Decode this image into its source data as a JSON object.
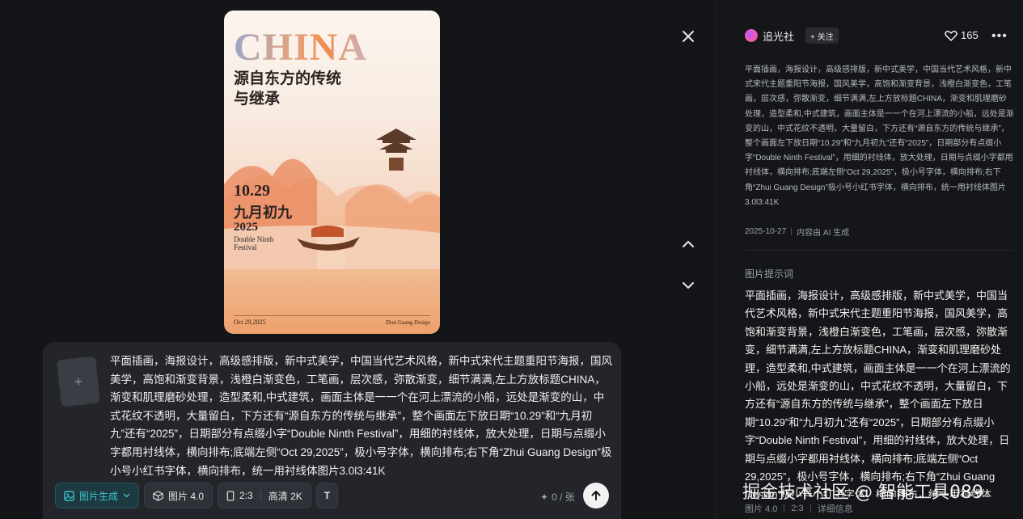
{
  "poster": {
    "headline": "CHINA",
    "title": "源自东方的传统与继承",
    "date_num": "10.29",
    "date_cn": "九月初九",
    "year": "2025",
    "festival": "Double Ninth Festival",
    "foot_date": "Oct 29,2025",
    "foot_brand": "Zhui Guang Design"
  },
  "icons": {
    "close": "close-icon",
    "up": "chevron-up-icon",
    "down": "chevron-down-icon",
    "heart": "heart-icon",
    "more": "more-icon",
    "send": "arrow-up-icon",
    "add": "plus-icon"
  },
  "composer": {
    "add_symbol": "+",
    "prompt": "平面插画，海报设计，高级感排版，新中式美学，中国当代艺术风格，新中式宋代主题重阳节海报，国风美学，高饱和渐变背景，浅橙白渐变色，工笔画，层次感，弥散渐变，细节满满,左上方放标题CHINA，渐变和肌理磨砂处理，造型柔和,中式建筑，画面主体是一一个在河上漂流的小船，远处是渐变的山，中式花纹不透明，大量留白，下方还有“源自东方的传统与继承”，整个画面左下放日期“10.29”和“九月初九”还有“2025”，日期部分有点缀小字“Double Ninth Festival”，用细的衬线体，放大处理，日期与点缀小字都用衬线体，横向排布;底端左侧“Oct 29,2025”，极小号字体，横向排布;右下角“Zhui Guang Design”极小号小红书字体，横向排布，统一用衬线体图片3.0l3:41K",
    "mode_label": "图片生成",
    "model_label": "图片 4.0",
    "ratio_label": "2:3",
    "quality_label": "高清 2K",
    "text_tool_label": "T",
    "counter": "0 / 张"
  },
  "panel": {
    "author": "追光社",
    "follow_label": "+ 关注",
    "likes": "165",
    "description": "平面插画，海报设计，高级感排版，新中式美学，中国当代艺术风格，新中式宋代主题重阳节海报，国风美学，高饱和渐变背景，浅橙白渐变色，工笔画，层次感，弥散渐变，细节满满,左上方放标题CHINA，渐变和肌理磨砂处理，造型柔和,中式建筑，画面主体是一一个在河上漂流的小船，远处是渐变的山，中式花纹不透明，大量留白，下方还有“源自东方的传统与继承”，整个画面左下放日期“10.29”和“九月初九”还有“2025”，日期部分有点缀小字“Double Ninth Festival”，用细的衬线体，放大处理，日期与点缀小字都用衬线体，横向排布;底端左侧“Oct 29,2025”，极小号字体，横向排布;右下角“Zhui Guang Design”极小号小红书字体，横向排布，统一用衬线体图片3.0l3:41K",
    "date": "2025-10-27",
    "ai_note": "内容由 AI 生成",
    "section_title": "图片提示词",
    "prompt": "平面插画，海报设计，高级感排版，新中式美学，中国当代艺术风格，新中式宋代主题重阳节海报，国风美学，高饱和渐变背景，浅橙白渐变色，工笔画，层次感，弥散渐变，细节满满,左上方放标题CHINA，渐变和肌理磨砂处理，造型柔和,中式建筑，画面主体是一一个在河上漂流的小船，远处是渐变的山，中式花纹不透明，大量留白，下方还有“源自东方的传统与继承”，整个画面左下放日期“10.29”和“九月初九”还有“2025”，日期部分有点缀小字“Double Ninth Festival”，用细的衬线体，放大处理，日期与点缀小字都用衬线体，横向排布;底端左侧“Oct 29,2025”，极小号字体，横向排布;右下角“Zhui Guang Design”极小号小红书字体，横向排布，统一用衬线体",
    "model": "图片 4.0",
    "ratio": "2:3",
    "details_label": "详细信息"
  },
  "watermark": "掘金技术社区 @ 智能工具089"
}
